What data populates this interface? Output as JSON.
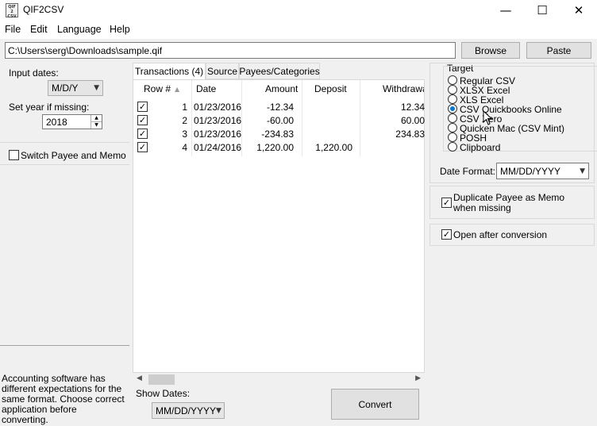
{
  "window": {
    "title": "QIF2CSV",
    "icon_text": "QIF\n2\nCSV",
    "minimize": "—",
    "maximize": "☐",
    "close": "✕"
  },
  "menu": [
    "File",
    "Edit",
    "Language",
    "Help"
  ],
  "path": {
    "value": "C:\\Users\\serg\\Downloads\\sample.qif",
    "browse_label": "Browse",
    "paste_label": "Paste"
  },
  "left": {
    "input_dates_label": "Input dates:",
    "input_dates_value": "M/D/Y",
    "year_label": "Set year if missing:",
    "year_value": "2018",
    "switch_label": "Switch Payee and Memo",
    "switch_checked": false,
    "help_text": "Accounting software has different expectations for the same format. Choose correct application before converting."
  },
  "tabs": [
    {
      "label": "Transactions (4)",
      "active": true
    },
    {
      "label": "Source",
      "active": false
    },
    {
      "label": "Payees/Categories",
      "active": false
    }
  ],
  "table": {
    "columns": [
      "Row #",
      "Date",
      "Amount",
      "Deposit",
      "Withdrawal"
    ],
    "rows": [
      {
        "checked": true,
        "row": "1",
        "date": "01/23/2016",
        "amount": "-12.34",
        "deposit": "",
        "withdrawal": "12.34"
      },
      {
        "checked": true,
        "row": "2",
        "date": "01/23/2016",
        "amount": "-60.00",
        "deposit": "",
        "withdrawal": "60.00"
      },
      {
        "checked": true,
        "row": "3",
        "date": "01/23/2016",
        "amount": "-234.83",
        "deposit": "",
        "withdrawal": "234.83"
      },
      {
        "checked": true,
        "row": "4",
        "date": "01/24/2016",
        "amount": "1,220.00",
        "deposit": "1,220.00",
        "withdrawal": ""
      }
    ]
  },
  "bottom": {
    "show_dates_label": "Show Dates:",
    "show_dates_value": "MM/DD/YYYY",
    "convert_label": "Convert"
  },
  "target": {
    "legend": "Target",
    "options": [
      "Regular CSV",
      "XLSX Excel",
      "XLS Excel",
      "CSV Quickbooks Online",
      "CSV Xero",
      "Quicken Mac (CSV Mint)",
      "POSH",
      "Clipboard"
    ],
    "selected_index": 3,
    "date_format_label": "Date Format:",
    "date_format_value": "MM/DD/YYYY",
    "duplicate_label": "Duplicate Payee as Memo when missing",
    "duplicate_checked": true,
    "open_after_label": "Open after conversion",
    "open_after_checked": true
  }
}
